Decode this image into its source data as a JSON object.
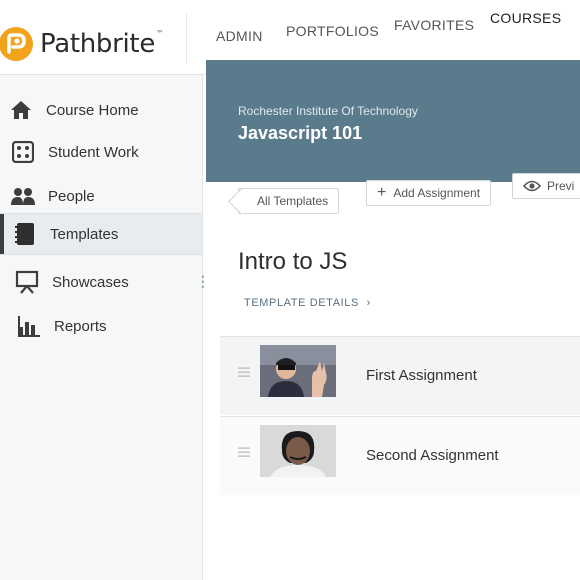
{
  "brand": {
    "name": "Pathbrite",
    "trademark": "™",
    "accent": "#f2a21b"
  },
  "topnav": {
    "admin": "ADMIN",
    "portfolios": "PORTFOLIOS",
    "favorites": "FAVORITES",
    "courses": "COURSES"
  },
  "sidebar": {
    "items": [
      {
        "label": "Course Home",
        "icon": "house-icon"
      },
      {
        "label": "Student Work",
        "icon": "dice-icon"
      },
      {
        "label": "People",
        "icon": "people-icon"
      },
      {
        "label": "Templates",
        "icon": "notebook-icon",
        "active": true
      },
      {
        "label": "Showcases",
        "icon": "easel-icon"
      },
      {
        "label": "Reports",
        "icon": "bar-chart-icon"
      }
    ]
  },
  "course": {
    "school": "Rochester Institute Of Technology",
    "title": "Javascript 101",
    "banner_color": "#5a7b8c"
  },
  "toolbar": {
    "back_label": "All Templates",
    "add_label": "Add Assignment",
    "add_icon": "plus-icon",
    "preview_label": "Previ",
    "preview_icon": "eye-icon"
  },
  "template": {
    "title": "Intro to JS",
    "details_label": "TEMPLATE DETAILS",
    "details_icon": "chevron-right-icon"
  },
  "assignments": [
    {
      "name": "First Assignment",
      "thumbnail": "photo-person-waving"
    },
    {
      "name": "Second Assignment",
      "thumbnail": "photo-person-portrait"
    }
  ]
}
